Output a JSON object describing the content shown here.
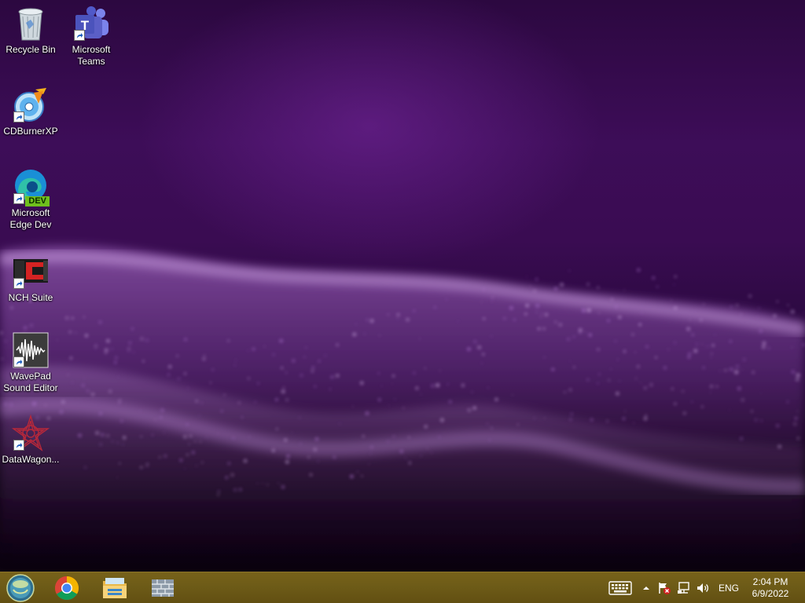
{
  "desktop": {
    "icons": [
      {
        "label": "Recycle Bin",
        "icon": "recycle-bin-icon"
      },
      {
        "label": "Microsoft\nTeams",
        "icon": "teams-icon"
      },
      {
        "label": "CDBurnerXP",
        "icon": "cdburnerxp-icon"
      },
      {
        "label": "Microsoft\nEdge Dev",
        "icon": "edge-dev-icon",
        "badge": "DEV"
      },
      {
        "label": "NCH Suite",
        "icon": "nch-suite-icon"
      },
      {
        "label": "WavePad\nSound Editor",
        "icon": "wavepad-icon"
      },
      {
        "label": "DataWagon...",
        "icon": "datawagon-icon"
      }
    ]
  },
  "taskbar": {
    "start": {
      "icon": "start-orb-icon"
    },
    "pinned": [
      {
        "icon": "chrome-icon"
      },
      {
        "icon": "file-explorer-icon"
      },
      {
        "icon": "firewall-icon"
      }
    ],
    "tray": {
      "keyboard_icon": "touch-keyboard-icon",
      "overflow_icon": "show-hidden-icons-arrow",
      "action_center_icon": "action-center-flag-icon",
      "network_icon": "network-icon",
      "volume_icon": "volume-icon",
      "language": "ENG"
    },
    "clock": {
      "time": "2:04 PM",
      "date": "6/9/2022"
    }
  },
  "colors": {
    "taskbar": "#6c5a17",
    "wallpaper_purple": "#3d0d58"
  }
}
